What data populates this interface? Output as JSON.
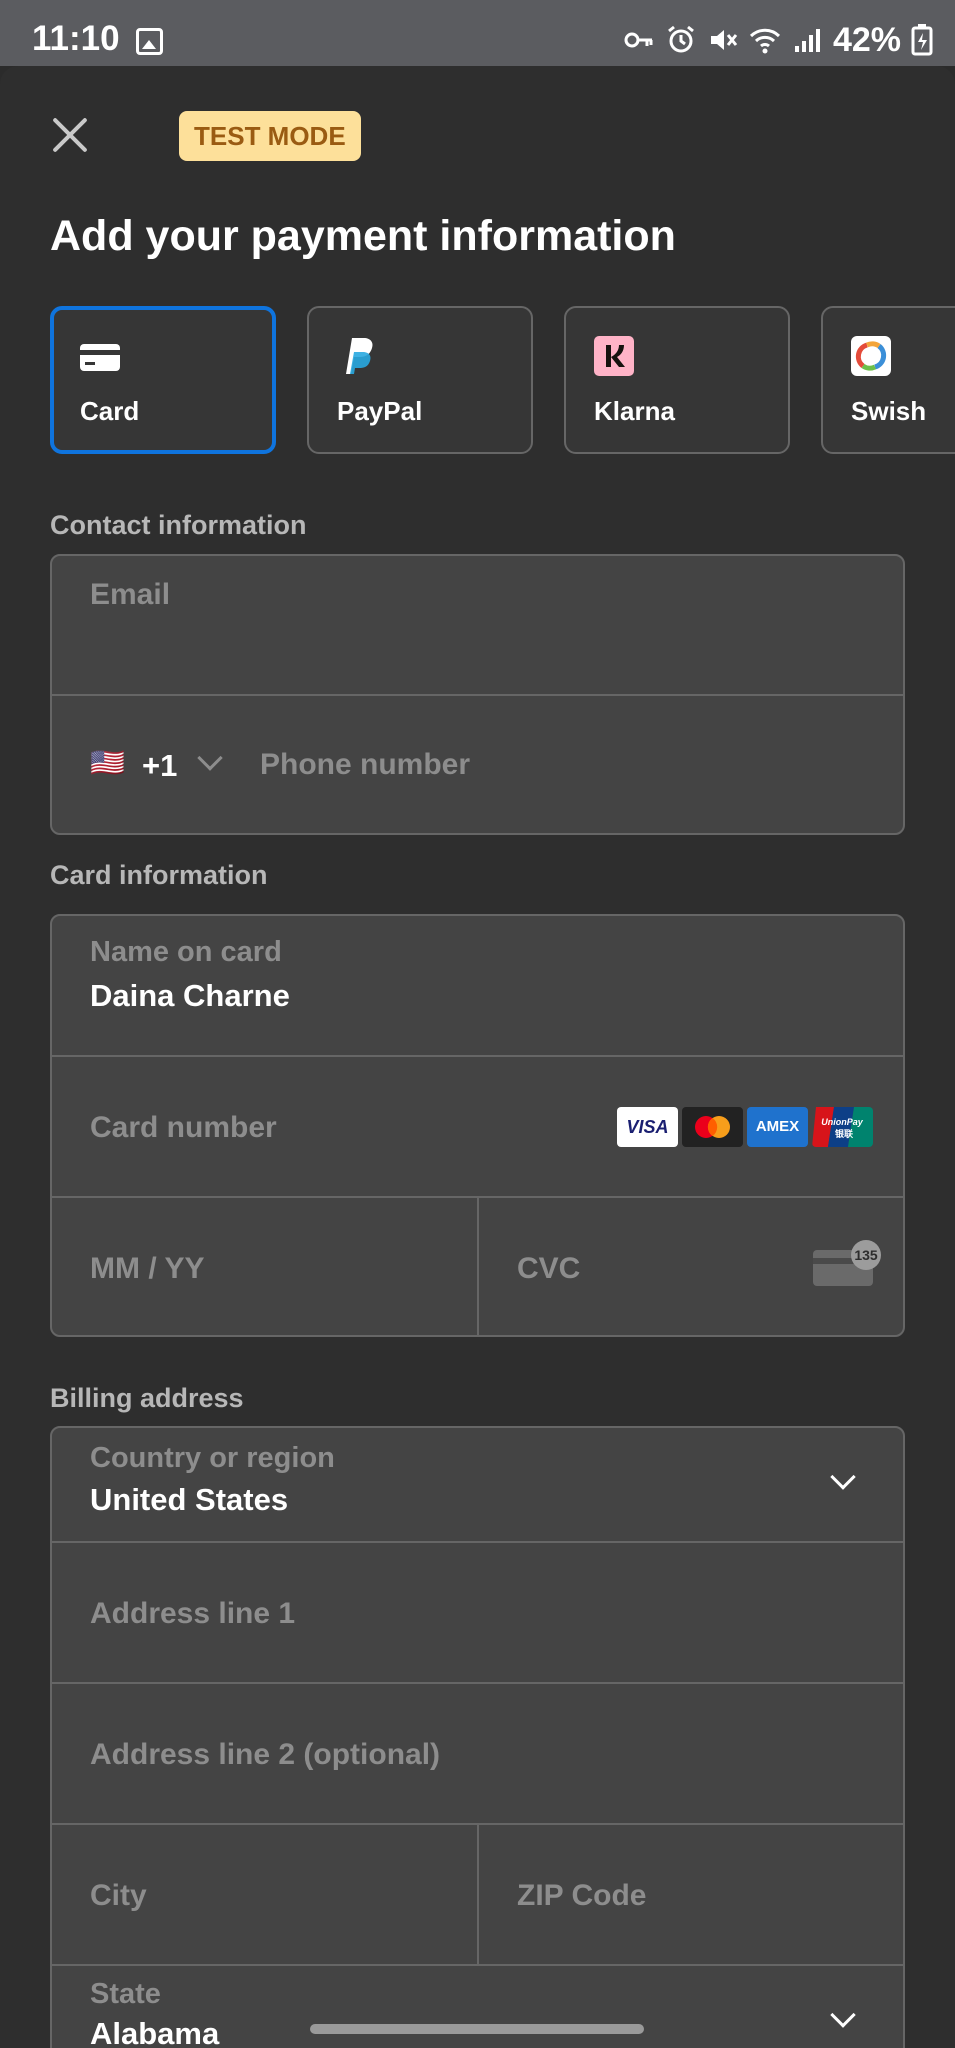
{
  "status_bar": {
    "time": "11:10",
    "battery": "42%",
    "icons": [
      "gallery-icon",
      "vpn-key-icon",
      "alarm-icon",
      "mute-icon",
      "wifi-icon",
      "signal-icon",
      "battery-charging-icon"
    ]
  },
  "header": {
    "badge": "TEST MODE",
    "title": "Add your payment information"
  },
  "payment_methods": [
    {
      "label": "Card",
      "icon": "card-icon",
      "selected": true
    },
    {
      "label": "PayPal",
      "icon": "paypal-icon",
      "selected": false
    },
    {
      "label": "Klarna",
      "icon": "klarna-icon",
      "selected": false
    },
    {
      "label": "Swish",
      "icon": "swish-icon",
      "selected": false
    }
  ],
  "contact": {
    "section_label": "Contact information",
    "email_placeholder": "Email",
    "phone_country_flag": "🇺🇸",
    "phone_code": "+1",
    "phone_placeholder": "Phone number"
  },
  "card": {
    "section_label": "Card information",
    "name_label": "Name on card",
    "name_value": "Daina Charne",
    "number_placeholder": "Card number",
    "brands": [
      "VISA",
      "Mastercard",
      "AMEX",
      "UnionPay"
    ],
    "expiry_placeholder": "MM / YY",
    "cvc_placeholder": "CVC",
    "cvc_hint": "135"
  },
  "billing": {
    "section_label": "Billing address",
    "country_label": "Country or region",
    "country_value": "United States",
    "address1_placeholder": "Address line 1",
    "address2_placeholder": "Address line 2 (optional)",
    "city_placeholder": "City",
    "zip_placeholder": "ZIP Code",
    "state_label": "State",
    "state_value": "Alabama"
  },
  "colors": {
    "accent": "#0f74de",
    "badge_bg": "#fde09a",
    "badge_text": "#9a5b12",
    "background": "#2e2e2e",
    "field_bg": "#444444"
  }
}
